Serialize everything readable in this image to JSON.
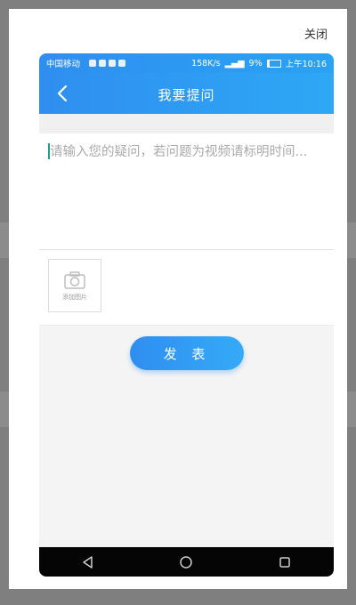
{
  "modal": {
    "close_label": "关闭"
  },
  "status_bar": {
    "carrier": "中国移动",
    "network_speed": "158K/s",
    "battery": "9%",
    "time": "上午10:16"
  },
  "header": {
    "title": "我要提问",
    "back_icon": "chevron-left-icon"
  },
  "question": {
    "placeholder": "请输入您的疑问，若问题为视频请标明时间...",
    "value": ""
  },
  "photo": {
    "add_label": "添加图片",
    "icon": "camera-icon"
  },
  "actions": {
    "publish_label": "发 表"
  },
  "navigation": {
    "back_icon": "triangle-back-icon",
    "home_icon": "circle-home-icon",
    "recents_icon": "square-recents-icon"
  },
  "colors": {
    "accent": "#2f8ef0",
    "accent_light": "#35aaf7",
    "nav_bar": "#050505"
  }
}
